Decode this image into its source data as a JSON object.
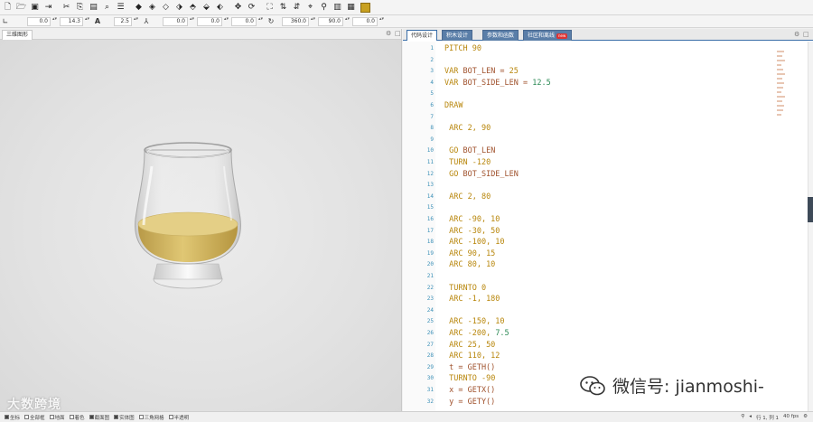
{
  "toolbar2": {
    "fields": [
      "0.0",
      "14.3",
      "2.5",
      "0.0",
      "0.0",
      "0.0",
      "360.0",
      "90.0",
      "0.0"
    ],
    "font_glyph": "A"
  },
  "left_panel": {
    "tab": "三维图形",
    "controls": [
      "⚙",
      "□"
    ]
  },
  "right_panel": {
    "tabs": [
      {
        "label": "代码设计"
      },
      {
        "label": "积木设计"
      },
      {
        "label": "参数和函数"
      },
      {
        "label": "社区和离线",
        "badge": "new"
      }
    ],
    "controls": [
      "⚙",
      "□"
    ]
  },
  "code": [
    {
      "n": "1",
      "t": [
        [
          "kw",
          "PITCH "
        ],
        [
          "num-o",
          "90"
        ]
      ]
    },
    {
      "n": "2",
      "t": []
    },
    {
      "n": "3",
      "t": [
        [
          "kw",
          "VAR "
        ],
        [
          "ident",
          "BOT_LEN = "
        ],
        [
          "num-o",
          "25"
        ]
      ]
    },
    {
      "n": "4",
      "t": [
        [
          "kw",
          "VAR "
        ],
        [
          "ident",
          "BOT_SIDE_LEN = "
        ],
        [
          "num-g",
          "12.5"
        ]
      ]
    },
    {
      "n": "5",
      "t": []
    },
    {
      "n": "6",
      "t": [
        [
          "kw",
          "DRAW"
        ]
      ]
    },
    {
      "n": "7",
      "t": []
    },
    {
      "n": "8",
      "t": [
        [
          "kw",
          " ARC "
        ],
        [
          "num-o",
          "2, 90"
        ]
      ]
    },
    {
      "n": "9",
      "t": []
    },
    {
      "n": "10",
      "t": [
        [
          "kw",
          " GO "
        ],
        [
          "ident",
          "BOT_LEN"
        ]
      ]
    },
    {
      "n": "11",
      "t": [
        [
          "kw",
          " TURN "
        ],
        [
          "num-o",
          "-120"
        ]
      ]
    },
    {
      "n": "12",
      "t": [
        [
          "kw",
          " GO "
        ],
        [
          "ident",
          "BOT_SIDE_LEN"
        ]
      ]
    },
    {
      "n": "13",
      "t": []
    },
    {
      "n": "14",
      "t": [
        [
          "kw",
          " ARC "
        ],
        [
          "num-o",
          "2, 80"
        ]
      ]
    },
    {
      "n": "15",
      "t": []
    },
    {
      "n": "16",
      "t": [
        [
          "kw",
          " ARC "
        ],
        [
          "num-o",
          "-90, 10"
        ]
      ]
    },
    {
      "n": "17",
      "t": [
        [
          "kw",
          " ARC "
        ],
        [
          "num-o",
          "-30, 50"
        ]
      ]
    },
    {
      "n": "18",
      "t": [
        [
          "kw",
          " ARC "
        ],
        [
          "num-o",
          "-100, 10"
        ]
      ]
    },
    {
      "n": "19",
      "t": [
        [
          "kw",
          " ARC "
        ],
        [
          "num-o",
          "90, 15"
        ]
      ]
    },
    {
      "n": "20",
      "t": [
        [
          "kw",
          " ARC "
        ],
        [
          "num-o",
          "80, 10"
        ]
      ]
    },
    {
      "n": "21",
      "t": []
    },
    {
      "n": "22",
      "t": [
        [
          "kw",
          " TURNTO "
        ],
        [
          "num-o",
          "0"
        ]
      ]
    },
    {
      "n": "23",
      "t": [
        [
          "kw",
          " ARC "
        ],
        [
          "num-o",
          "-1, 180"
        ]
      ]
    },
    {
      "n": "24",
      "t": []
    },
    {
      "n": "25",
      "t": [
        [
          "kw",
          " ARC "
        ],
        [
          "num-o",
          "-150, 10"
        ]
      ]
    },
    {
      "n": "26",
      "t": [
        [
          "kw",
          " ARC "
        ],
        [
          "num-o",
          "-200, "
        ],
        [
          "num-g",
          "7.5"
        ]
      ]
    },
    {
      "n": "27",
      "t": [
        [
          "kw",
          " ARC "
        ],
        [
          "num-o",
          "25, 50"
        ]
      ]
    },
    {
      "n": "28",
      "t": [
        [
          "kw",
          " ARC "
        ],
        [
          "num-o",
          "110, 12"
        ]
      ]
    },
    {
      "n": "29",
      "t": [
        [
          "ident",
          " t = GETH()"
        ]
      ]
    },
    {
      "n": "30",
      "t": [
        [
          "kw",
          " TURNTO "
        ],
        [
          "num-o",
          "-90"
        ]
      ]
    },
    {
      "n": "31",
      "t": [
        [
          "ident",
          " x = GETX()"
        ]
      ]
    },
    {
      "n": "32",
      "t": [
        [
          "ident",
          " y = GETY()"
        ]
      ]
    }
  ],
  "status": {
    "checks": [
      {
        "label": "坐标",
        "on": true
      },
      {
        "label": "全部框",
        "on": false
      },
      {
        "label": "地面",
        "on": false
      },
      {
        "label": "着色",
        "on": false
      },
      {
        "label": "截面图",
        "on": true
      },
      {
        "label": "实体图",
        "on": true
      },
      {
        "label": "三角网格",
        "on": false
      },
      {
        "label": "半透明",
        "on": false
      }
    ],
    "right": [
      "⚲",
      "◂",
      "行 1, 列 1",
      "40 fps",
      "⚙"
    ]
  },
  "watermarks": {
    "left": "大数跨境",
    "right": "微信号: jianmoshi-"
  }
}
